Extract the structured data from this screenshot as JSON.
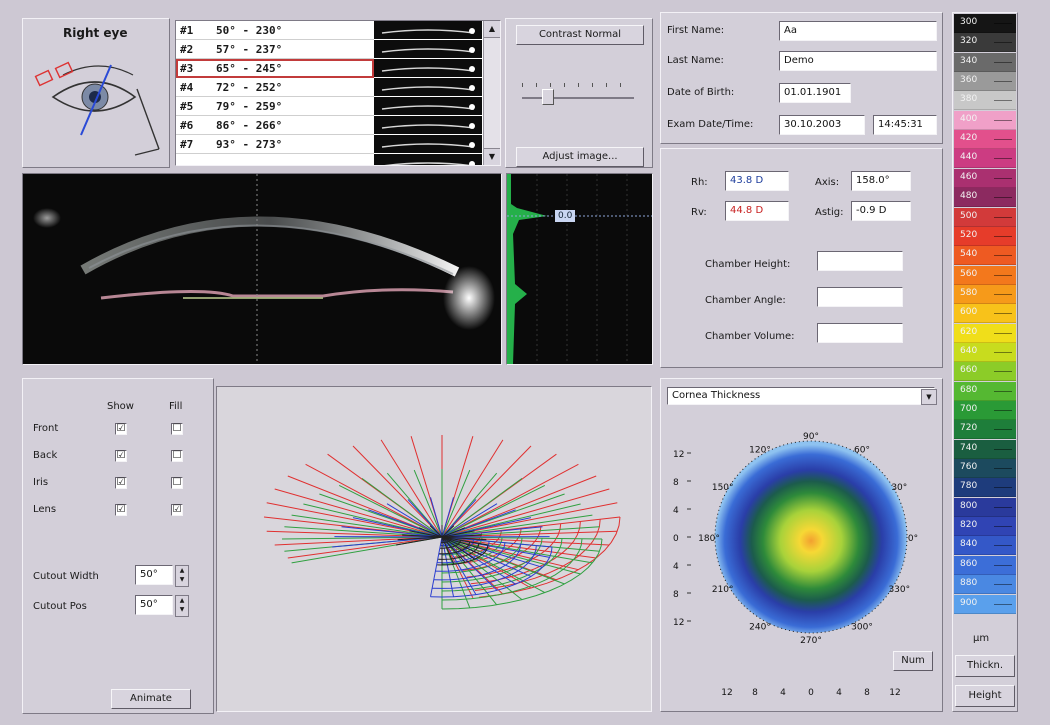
{
  "eye_panel": {
    "title": "Right eye"
  },
  "image_list": [
    {
      "num": "#1",
      "range": "50° - 230°"
    },
    {
      "num": "#2",
      "range": "57° - 237°"
    },
    {
      "num": "#3",
      "range": "65° - 245°"
    },
    {
      "num": "#4",
      "range": "72° - 252°"
    },
    {
      "num": "#5",
      "range": "79° - 259°"
    },
    {
      "num": "#6",
      "range": "86° - 266°"
    },
    {
      "num": "#7",
      "range": "93° - 273°"
    }
  ],
  "controls": {
    "contrast_label": "Contrast Normal",
    "adjust_label": "Adjust image..."
  },
  "densitometry": {
    "value": "0.0"
  },
  "patient": {
    "first_name_label": "First Name:",
    "first_name": "Aa",
    "last_name_label": "Last Name:",
    "last_name": "Demo",
    "dob_label": "Date of Birth:",
    "dob": "01.01.1901",
    "exam_label": "Exam Date/Time:",
    "exam_date": "30.10.2003",
    "exam_time": "14:45:31"
  },
  "keratometry": {
    "rh_label": "Rh:",
    "rh": "43.8 D",
    "rv_label": "Rv:",
    "rv": "44.8 D",
    "axis_label": "Axis:",
    "axis": "158.0°",
    "astig_label": "Astig:",
    "astig": "-0.9 D",
    "chamber_height_label": "Chamber Height:",
    "chamber_angle_label": "Chamber Angle:",
    "chamber_volume_label": "Chamber Volume:"
  },
  "surfaces": {
    "show_label": "Show",
    "fill_label": "Fill",
    "rows": [
      {
        "label": "Front",
        "show": "☑",
        "fill": "☐"
      },
      {
        "label": "Back",
        "show": "☑",
        "fill": "☐"
      },
      {
        "label": "Iris",
        "show": "☑",
        "fill": "☐"
      },
      {
        "label": "Lens",
        "show": "☑",
        "fill": "☑"
      }
    ],
    "cutout_width_label": "Cutout Width",
    "cutout_width": "50°",
    "cutout_pos_label": "Cutout Pos",
    "cutout_pos": "50°",
    "animate_label": "Animate"
  },
  "map": {
    "dropdown": "Cornea Thickness",
    "angle_labels": [
      "90°",
      "60°",
      "30°",
      "0°",
      "330°",
      "300°",
      "270°",
      "240°",
      "210°",
      "180°",
      "150°",
      "120°"
    ],
    "y_ticks": [
      "12",
      "8",
      "4",
      "0",
      "4",
      "8",
      "12"
    ],
    "x_ticks": [
      "12",
      "8",
      "4",
      "0",
      "4",
      "8",
      "12"
    ],
    "num_label": "Num"
  },
  "scale": {
    "values": [
      "300",
      "320",
      "340",
      "360",
      "380",
      "400",
      "420",
      "440",
      "460",
      "480",
      "500",
      "520",
      "540",
      "560",
      "580",
      "600",
      "620",
      "640",
      "660",
      "680",
      "700",
      "720",
      "740",
      "760",
      "780",
      "800",
      "820",
      "840",
      "860",
      "880",
      "900"
    ],
    "colors": [
      "#151515",
      "#3a3a3a",
      "#6a6a6a",
      "#9a9a9a",
      "#c8c8c8",
      "#f0a0c8",
      "#e2508c",
      "#cc3c82",
      "#aa3070",
      "#8c2a60",
      "#d23a3a",
      "#e63c2a",
      "#ee5a22",
      "#f3781c",
      "#f69a1a",
      "#f8c21a",
      "#f0de1a",
      "#c8dc1e",
      "#8ccc28",
      "#55b832",
      "#2a9a36",
      "#1e7e3a",
      "#1a5e40",
      "#1c4a5e",
      "#1e3c7c",
      "#2a3a9c",
      "#3044b4",
      "#3458c8",
      "#3c6ed8",
      "#4a88e2",
      "#5aa0ec"
    ],
    "unit": "µm",
    "thickness_label": "Thickn.",
    "height_label": "Height"
  }
}
